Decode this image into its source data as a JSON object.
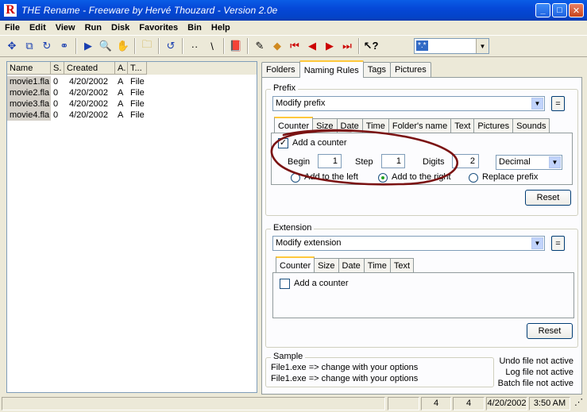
{
  "window": {
    "title": "THE Rename - Freeware by Hervé Thouzard - Version 2.0e",
    "logo_letter": "R",
    "min": "_",
    "max": "□",
    "close": "✕"
  },
  "menu": [
    "File",
    "Edit",
    "View",
    "Run",
    "Disk",
    "Favorites",
    "Bin",
    "Help"
  ],
  "toolbar": {
    "filter_value": "*.*",
    "dots": "··",
    "backslash": "\\"
  },
  "file_list": {
    "columns": [
      "Name",
      "S.",
      "Created",
      "A.",
      "T..."
    ],
    "rows": [
      [
        "movie1.fla",
        "0",
        "4/20/2002",
        "A",
        "File"
      ],
      [
        "movie2.fla",
        "0",
        "4/20/2002",
        "A",
        "File"
      ],
      [
        "movie3.fla",
        "0",
        "4/20/2002",
        "A",
        "File"
      ],
      [
        "movie4.fla",
        "0",
        "4/20/2002",
        "A",
        "File"
      ]
    ]
  },
  "tabs": [
    "Folders",
    "Naming Rules",
    "Tags",
    "Pictures"
  ],
  "prefix": {
    "label": "Prefix",
    "rule": "Modify prefix",
    "eq": "=",
    "subtabs": [
      "Counter",
      "Size",
      "Date",
      "Time",
      "Folder's name",
      "Text",
      "Pictures",
      "Sounds"
    ],
    "add_counter": "Add a counter",
    "begin_label": "Begin",
    "begin": "1",
    "step_label": "Step",
    "step": "1",
    "digits_label": "Digits",
    "digits": "2",
    "format": "Decimal",
    "add_left": "Add to the left",
    "add_right": "Add to the right",
    "replace": "Replace prefix",
    "reset": "Reset"
  },
  "extension": {
    "label": "Extension",
    "rule": "Modify extension",
    "eq": "=",
    "subtabs": [
      "Counter",
      "Size",
      "Date",
      "Time",
      "Text"
    ],
    "add_counter": "Add a counter",
    "reset": "Reset"
  },
  "sample": {
    "label": "Sample",
    "line1": "File1.exe => change with your options",
    "line2": "File1.exe => change with your options"
  },
  "status_right": [
    "Undo file not active",
    "Log file not active",
    "Batch file not active"
  ],
  "statusbar": {
    "count1": "4",
    "count2": "4",
    "date": "4/20/2002",
    "time": "3:50 AM"
  },
  "colors": {
    "highlight": "#7a1212",
    "selection": "#316ac5"
  }
}
